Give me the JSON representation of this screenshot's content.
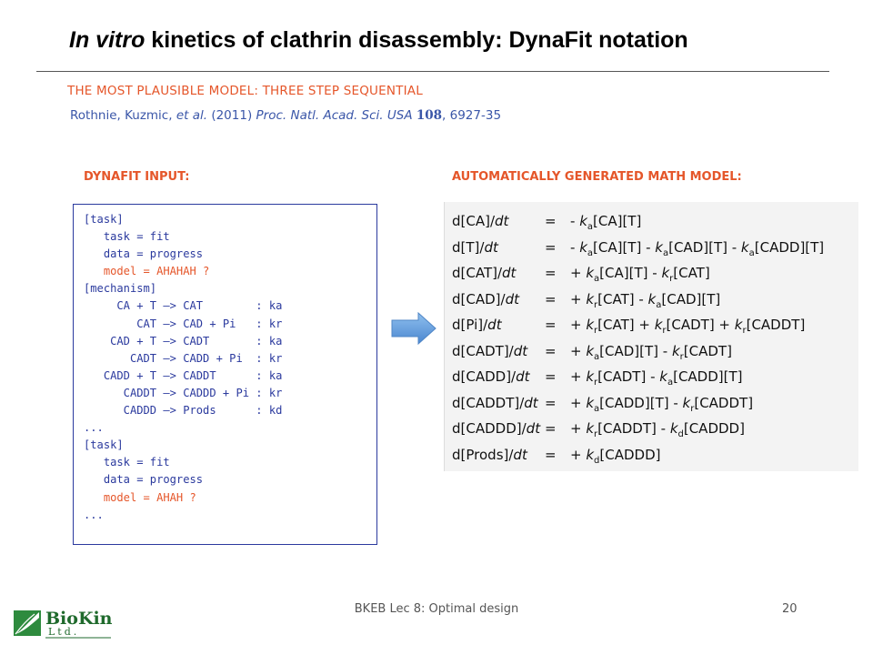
{
  "slide": {
    "title_italic": "In vitro",
    "title_rest": " kinetics of clathrin disassembly: DynaFit notation",
    "subtitle": "THE MOST PLAUSIBLE MODEL: THREE STEP SEQUENTIAL",
    "citation": {
      "authors": "Rothnie, Kuzmic, ",
      "etal": "et al.",
      "year": " (2011) ",
      "journal": "Proc. Natl. Acad. Sci. USA",
      "volume": "108",
      "pages": ", 6927-35"
    }
  },
  "input_panel": {
    "heading": "DYNAFIT INPUT:",
    "lines": [
      {
        "text": "[task]",
        "style": "std"
      },
      {
        "text": "   task = fit",
        "style": "std"
      },
      {
        "text": "   data = progress",
        "style": "std"
      },
      {
        "text": "   model = AHAHAH ?",
        "style": "model"
      },
      {
        "text": "[mechanism]",
        "style": "std"
      },
      {
        "text": "     CA + T —> CAT        : ka",
        "style": "std"
      },
      {
        "text": "        CAT —> CAD + Pi   : kr",
        "style": "std"
      },
      {
        "text": "    CAD + T —> CADT       : ka",
        "style": "std"
      },
      {
        "text": "       CADT —> CADD + Pi  : kr",
        "style": "std"
      },
      {
        "text": "   CADD + T —> CADDT      : ka",
        "style": "std"
      },
      {
        "text": "      CADDT —> CADDD + Pi : kr",
        "style": "std"
      },
      {
        "text": "      CADDD —> Prods      : kd",
        "style": "std"
      },
      {
        "text": "...",
        "style": "std"
      },
      {
        "text": "[task]",
        "style": "std"
      },
      {
        "text": "   task = fit",
        "style": "std"
      },
      {
        "text": "   data = progress",
        "style": "std"
      },
      {
        "text": "   model = AHAH ?",
        "style": "model"
      },
      {
        "text": "...",
        "style": "std"
      }
    ]
  },
  "math_panel": {
    "heading": "AUTOMATICALLY GENERATED MATH MODEL:",
    "equations": [
      {
        "lhs": "d[CA]/dt",
        "rhs": "- ka[CA][T]"
      },
      {
        "lhs": "d[T]/dt",
        "rhs": "- ka[CA][T] - ka[CAD][T] - ka[CADD][T]"
      },
      {
        "lhs": "d[CAT]/dt",
        "rhs": "+ ka[CA][T] - kr[CAT]"
      },
      {
        "lhs": "d[CAD]/dt",
        "rhs": "+ kr[CAT] - ka[CAD][T]"
      },
      {
        "lhs": "d[Pi]/dt",
        "rhs": "+ kr[CAT] + kr[CADT] + kr[CADDT]"
      },
      {
        "lhs": "d[CADT]/dt",
        "rhs": "+ ka[CAD][T] - kr[CADT]"
      },
      {
        "lhs": "d[CADD]/dt",
        "rhs": "+ kr[CADT] - ka[CADD][T]"
      },
      {
        "lhs": "d[CADDT]/dt",
        "rhs": "+ ka[CADD][T] - kr[CADDT]"
      },
      {
        "lhs": "d[CADDD]/dt",
        "rhs": "+ kr[CADDT] - kd[CADDD]"
      },
      {
        "lhs": "d[Prods]/dt",
        "rhs": "+ kd[CADDD]"
      }
    ]
  },
  "footer": {
    "course": "BKEB Lec 8: Optimal design",
    "page": "20"
  },
  "logo": {
    "name": "BioKin",
    "sub": "Ltd."
  },
  "colors": {
    "accent_orange": "#e5562a",
    "accent_blue": "#2b3a9e",
    "citation_blue": "#3a56a8",
    "arrow_blue": "#5b9bd5",
    "logo_green": "#1f6a2c"
  }
}
